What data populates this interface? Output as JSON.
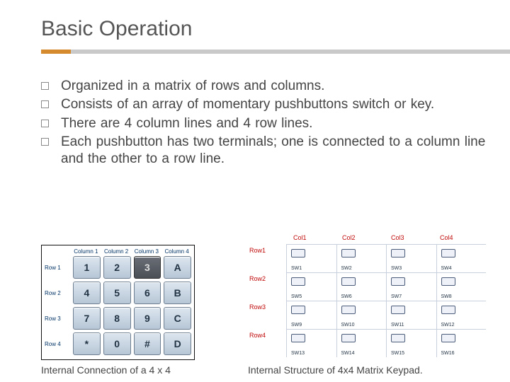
{
  "title": "Basic Operation",
  "bullets": [
    "Organized in a matrix of rows and columns.",
    "Consists of an array of momentary pushbuttons switch or key.",
    "There are 4 column lines and 4 row lines.",
    "Each pushbutton has two terminals; one is connected to a column line and the other to a row line."
  ],
  "fig_left": {
    "col_headers": [
      "Column 1",
      "Column 2",
      "Column 3",
      "Column 4"
    ],
    "row_headers": [
      "Row 1",
      "Row 2",
      "Row 3",
      "Row 4"
    ],
    "keys": [
      [
        "1",
        "2",
        "3",
        "A"
      ],
      [
        "4",
        "5",
        "6",
        "B"
      ],
      [
        "7",
        "8",
        "9",
        "C"
      ],
      [
        "*",
        "0",
        "#",
        "D"
      ]
    ],
    "pressed": [
      0,
      2
    ],
    "caption": "Internal Connection of a 4 x 4"
  },
  "fig_right": {
    "col_headers": [
      "Col1",
      "Col2",
      "Col3",
      "Col4"
    ],
    "row_headers": [
      "Row1",
      "Row2",
      "Row3",
      "Row4"
    ],
    "switches": [
      [
        "SW1",
        "SW2",
        "SW3",
        "SW4"
      ],
      [
        "SW5",
        "SW6",
        "SW7",
        "SW8"
      ],
      [
        "SW9",
        "SW10",
        "SW11",
        "SW12"
      ],
      [
        "SW13",
        "SW14",
        "SW15",
        "SW16"
      ]
    ],
    "caption": "Internal Structure of 4x4 Matrix Keypad."
  }
}
